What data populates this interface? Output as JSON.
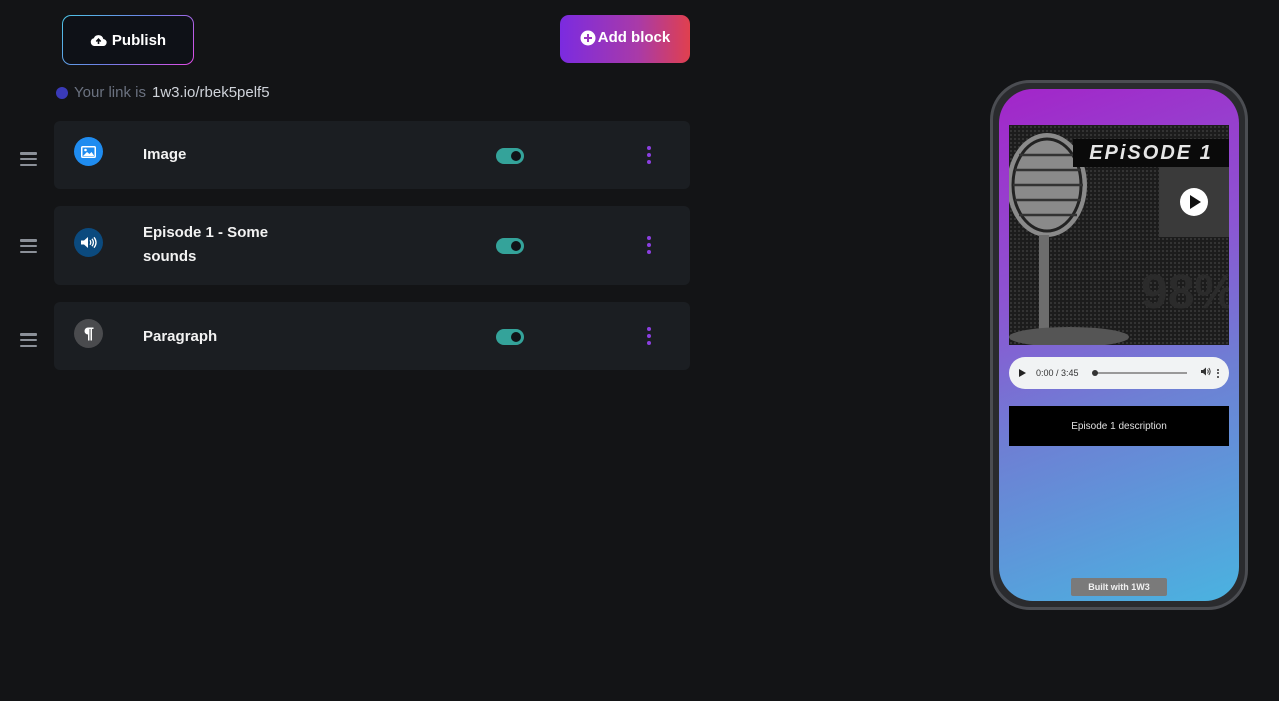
{
  "toolbar": {
    "publish_label": "Publish",
    "add_block_label": "Add block"
  },
  "link": {
    "prefix": "Your link is",
    "url": "1w3.io/rbek5pelf5"
  },
  "blocks": [
    {
      "title": "Image",
      "icon": "image-icon",
      "icon_color": "#1f8cf0",
      "enabled": true
    },
    {
      "title": "Episode 1 - Some sounds",
      "icon": "speaker-icon",
      "icon_color": "#0b4a7e",
      "enabled": true
    },
    {
      "title": "Paragraph",
      "icon": "pilcrow-icon",
      "icon_color": "#4a4b4e",
      "enabled": true
    }
  ],
  "preview": {
    "episode_banner": "EPiSODE 1",
    "audio_time": "0:00 / 3:45",
    "description": "Episode 1 description",
    "footer": "Built with 1W3"
  },
  "colors": {
    "background": "#131416",
    "card": "#1b1e22",
    "toggle_on": "#34a39a",
    "menu_dots": "#8b3fe0"
  }
}
